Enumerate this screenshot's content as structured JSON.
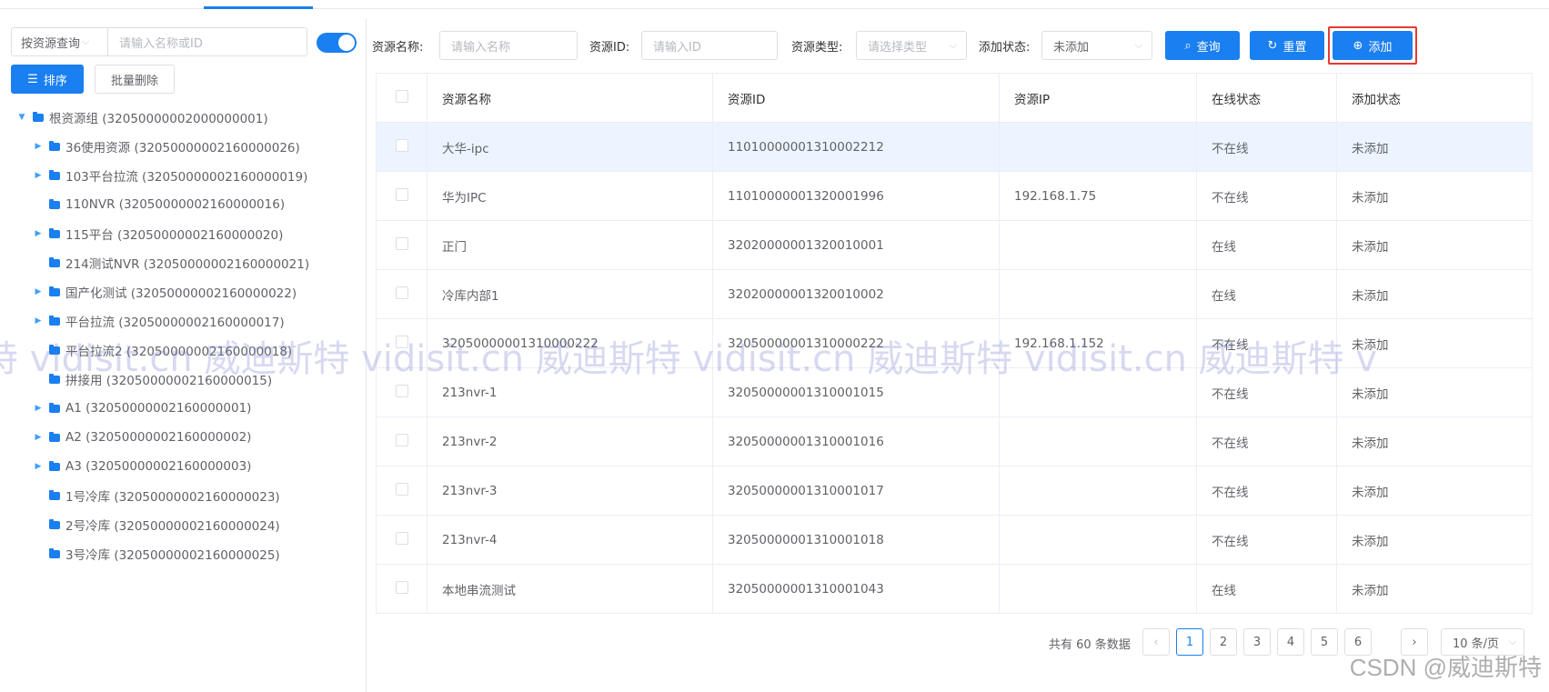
{
  "sidebar": {
    "search_type": "按资源查询",
    "search_placeholder": "请输入名称或ID",
    "sort_label": "排序",
    "bulk_delete_label": "批量删除",
    "tree": [
      {
        "label": "根资源组 (32050000002000000001)",
        "level": 0,
        "expanded": true
      },
      {
        "label": "36使用资源 (32050000002160000026)",
        "level": 1,
        "has_children": true
      },
      {
        "label": "103平台拉流 (32050000002160000019)",
        "level": 1,
        "has_children": true
      },
      {
        "label": "110NVR (32050000002160000016)",
        "level": 1,
        "has_children": false
      },
      {
        "label": "115平台 (32050000002160000020)",
        "level": 1,
        "has_children": true
      },
      {
        "label": "214测试NVR (32050000002160000021)",
        "level": 1,
        "has_children": false
      },
      {
        "label": "国产化测试 (32050000002160000022)",
        "level": 1,
        "has_children": true
      },
      {
        "label": "平台拉流 (32050000002160000017)",
        "level": 1,
        "has_children": true
      },
      {
        "label": "平台拉流2 (32050000002160000018)",
        "level": 1,
        "has_children": false
      },
      {
        "label": "拼接用 (32050000002160000015)",
        "level": 1,
        "has_children": false
      },
      {
        "label": "A1 (32050000002160000001)",
        "level": 1,
        "has_children": true
      },
      {
        "label": "A2 (32050000002160000002)",
        "level": 1,
        "has_children": true
      },
      {
        "label": "A3 (32050000002160000003)",
        "level": 1,
        "has_children": true
      },
      {
        "label": "1号冷库 (32050000002160000023)",
        "level": 1,
        "has_children": false
      },
      {
        "label": "2号冷库 (32050000002160000024)",
        "level": 1,
        "has_children": false
      },
      {
        "label": "3号冷库 (32050000002160000025)",
        "level": 1,
        "has_children": false
      }
    ]
  },
  "filters": {
    "name_label": "资源名称:",
    "name_placeholder": "请输入名称",
    "id_label": "资源ID:",
    "id_placeholder": "请输入ID",
    "type_label": "资源类型:",
    "type_placeholder": "请选择类型",
    "status_label": "添加状态:",
    "status_value": "未添加",
    "query_label": "查询",
    "reset_label": "重置",
    "add_label": "添加"
  },
  "table": {
    "headers": [
      "资源名称",
      "资源ID",
      "资源IP",
      "在线状态",
      "添加状态"
    ],
    "rows": [
      {
        "name": "大华-ipc",
        "id": "11010000001310002212",
        "ip": "",
        "online": "不在线",
        "added": "未添加",
        "highlight": true
      },
      {
        "name": "华为IPC",
        "id": "11010000001320001996",
        "ip": "192.168.1.75",
        "online": "不在线",
        "added": "未添加"
      },
      {
        "name": "正门",
        "id": "32020000001320010001",
        "ip": "",
        "online": "在线",
        "added": "未添加"
      },
      {
        "name": "冷库内部1",
        "id": "32020000001320010002",
        "ip": "",
        "online": "在线",
        "added": "未添加"
      },
      {
        "name": "32050000001310000222",
        "id": "32050000001310000222",
        "ip": "192.168.1.152",
        "online": "不在线",
        "added": "未添加"
      },
      {
        "name": "213nvr-1",
        "id": "32050000001310001015",
        "ip": "",
        "online": "不在线",
        "added": "未添加"
      },
      {
        "name": "213nvr-2",
        "id": "32050000001310001016",
        "ip": "",
        "online": "不在线",
        "added": "未添加"
      },
      {
        "name": "213nvr-3",
        "id": "32050000001310001017",
        "ip": "",
        "online": "不在线",
        "added": "未添加"
      },
      {
        "name": "213nvr-4",
        "id": "32050000001310001018",
        "ip": "",
        "online": "不在线",
        "added": "未添加"
      },
      {
        "name": "本地串流测试",
        "id": "32050000001310001043",
        "ip": "",
        "online": "在线",
        "added": "未添加"
      }
    ]
  },
  "pagination": {
    "total_text": "共有 60 条数据",
    "pages": [
      "1",
      "2",
      "3",
      "4",
      "5",
      "6"
    ],
    "current": "1",
    "page_size": "10 条/页"
  },
  "watermark": "特 vidisit.cn 威迪斯特 vidisit.cn 威迪斯特 vidisit.cn 威迪斯特 vidisit.cn 威迪斯特 v",
  "csdn_mark": "CSDN @威迪斯特",
  "colors": {
    "primary": "#1a7ff0",
    "highlight_border": "#e53935",
    "selected_row": "#ecf5ff"
  }
}
